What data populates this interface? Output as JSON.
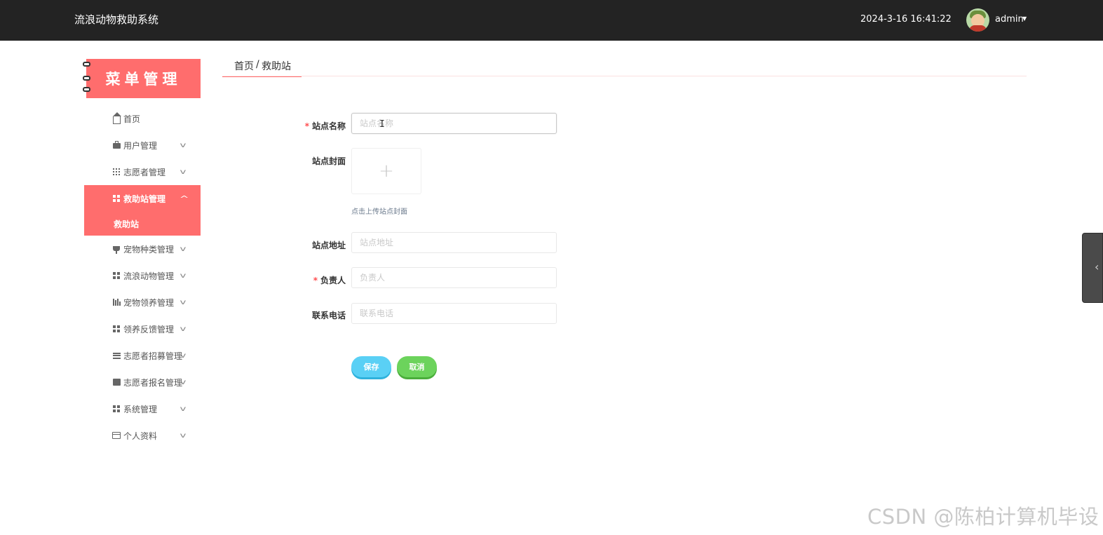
{
  "header": {
    "app_title": "流浪动物救助系统",
    "datetime": "2024-3-16 16:41:22",
    "username": "admin"
  },
  "sidebar": {
    "banner": "菜单管理",
    "items": [
      {
        "label": "首页",
        "icon": "home-icon",
        "has_chevron": false
      },
      {
        "label": "用户管理",
        "icon": "briefcase-icon",
        "has_chevron": true
      },
      {
        "label": "志愿者管理",
        "icon": "grid-dots-icon",
        "has_chevron": true
      },
      {
        "label": "救助站管理",
        "icon": "grid-icon",
        "has_chevron": true,
        "active": true
      },
      {
        "label": "宠物种类管理",
        "icon": "cup-icon",
        "has_chevron": true
      },
      {
        "label": "流浪动物管理",
        "icon": "grid-icon",
        "has_chevron": true
      },
      {
        "label": "宠物领养管理",
        "icon": "bars-icon",
        "has_chevron": true
      },
      {
        "label": "领养反馈管理",
        "icon": "grid-icon",
        "has_chevron": true
      },
      {
        "label": "志愿者招募管理",
        "icon": "list-icon",
        "has_chevron": true
      },
      {
        "label": "志愿者报名管理",
        "icon": "chart-icon",
        "has_chevron": true
      },
      {
        "label": "系统管理",
        "icon": "grid-icon",
        "has_chevron": true
      },
      {
        "label": "个人资料",
        "icon": "card-icon",
        "has_chevron": true
      }
    ],
    "sub_item": "救助站"
  },
  "breadcrumb": {
    "home": "首页",
    "separator": "/",
    "current": "救助站"
  },
  "form": {
    "station_name": {
      "label": "站点名称",
      "required": true,
      "placeholder": "站点名称",
      "value": ""
    },
    "cover": {
      "label": "站点封面",
      "upload_tip": "点击上传站点封面"
    },
    "address": {
      "label": "站点地址",
      "placeholder": "站点地址",
      "value": ""
    },
    "manager": {
      "label": "负责人",
      "required": true,
      "placeholder": "负责人",
      "value": ""
    },
    "phone": {
      "label": "联系电话",
      "placeholder": "联系电话",
      "value": ""
    },
    "required_mark": "*",
    "save_label": "保存",
    "cancel_label": "取消"
  },
  "watermark": "CSDN @陈柏计算机毕设",
  "colors": {
    "topbar": "#232323",
    "accent": "#ff6d6d",
    "save_button": "#5ad0f5",
    "cancel_button": "#6cd35c"
  }
}
